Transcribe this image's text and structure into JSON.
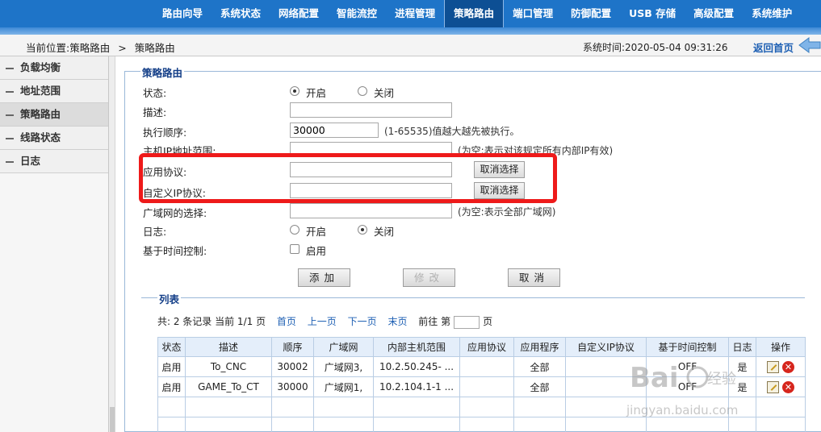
{
  "nav": {
    "items": [
      "路由向导",
      "系统状态",
      "网络配置",
      "智能流控",
      "进程管理",
      "策略路由",
      "端口管理",
      "防御配置",
      "USB 存储",
      "高级配置",
      "系统维护"
    ],
    "active_index": 5
  },
  "crumbbar": {
    "location_label": "当前位置:策略路由",
    "separator": ">",
    "current": "策略路由",
    "system_time": "系统时间:2020-05-04 09:31:26",
    "back_label": "返回首页"
  },
  "sidebar": {
    "items": [
      "负载均衡",
      "地址范围",
      "策略路由",
      "线路状态",
      "日志"
    ],
    "active_index": 2
  },
  "form": {
    "legend": "策略路由",
    "status_label": "状态:",
    "status_on": "开启",
    "status_off": "关闭",
    "status_value": "开启",
    "desc_label": "描述:",
    "desc_value": "",
    "order_label": "执行顺序:",
    "order_value": "30000",
    "order_hint": "(1-65535)值越大越先被执行。",
    "host_range_label": "主机IP地址范围:",
    "host_range_hint": "(为空:表示对该规定所有内部IP有效)",
    "app_proto_label": "应用协议:",
    "custom_ip_label": "自定义IP协议:",
    "cancel_select": "取消选择",
    "wan_label": "广域网的选择:",
    "wan_hint": "(为空:表示全部广域网)",
    "log_label": "日志:",
    "log_on": "开启",
    "log_off": "关闭",
    "log_value": "关闭",
    "time_ctrl_label": "基于时间控制:",
    "time_ctrl_enable": "启用",
    "time_ctrl_checked": false,
    "add_btn": "添加",
    "modify_btn": "修改",
    "cancel_btn": "取消"
  },
  "list": {
    "legend": "列表",
    "summary": "共: 2 条记录 当前 1/1 页",
    "first": "首页",
    "prev": "上一页",
    "next": "下一页",
    "last": "末页",
    "goto_prefix": "前往 第",
    "goto_suffix": "页",
    "columns": [
      "状态",
      "描述",
      "顺序",
      "广域网",
      "内部主机范围",
      "应用协议",
      "应用程序",
      "自定义IP协议",
      "基于时间控制",
      "日志",
      "操作"
    ],
    "rows": [
      [
        "启用",
        "To_CNC",
        "30002",
        "广域网3,",
        "10.2.50.245- ...",
        "",
        "全部",
        "",
        "OFF",
        "是"
      ],
      [
        "启用",
        "GAME_To_CT",
        "30000",
        "广域网1,",
        "10.2.104.1-1 ...",
        "",
        "全部",
        "",
        "OFF",
        "是"
      ]
    ]
  },
  "watermark": "Baidu 经验 jingyan.baidu.com",
  "colors": {
    "nav_bg": "#1e74c8",
    "accent_link": "#1d5fb3",
    "highlight_box": "#ee1a1a"
  }
}
